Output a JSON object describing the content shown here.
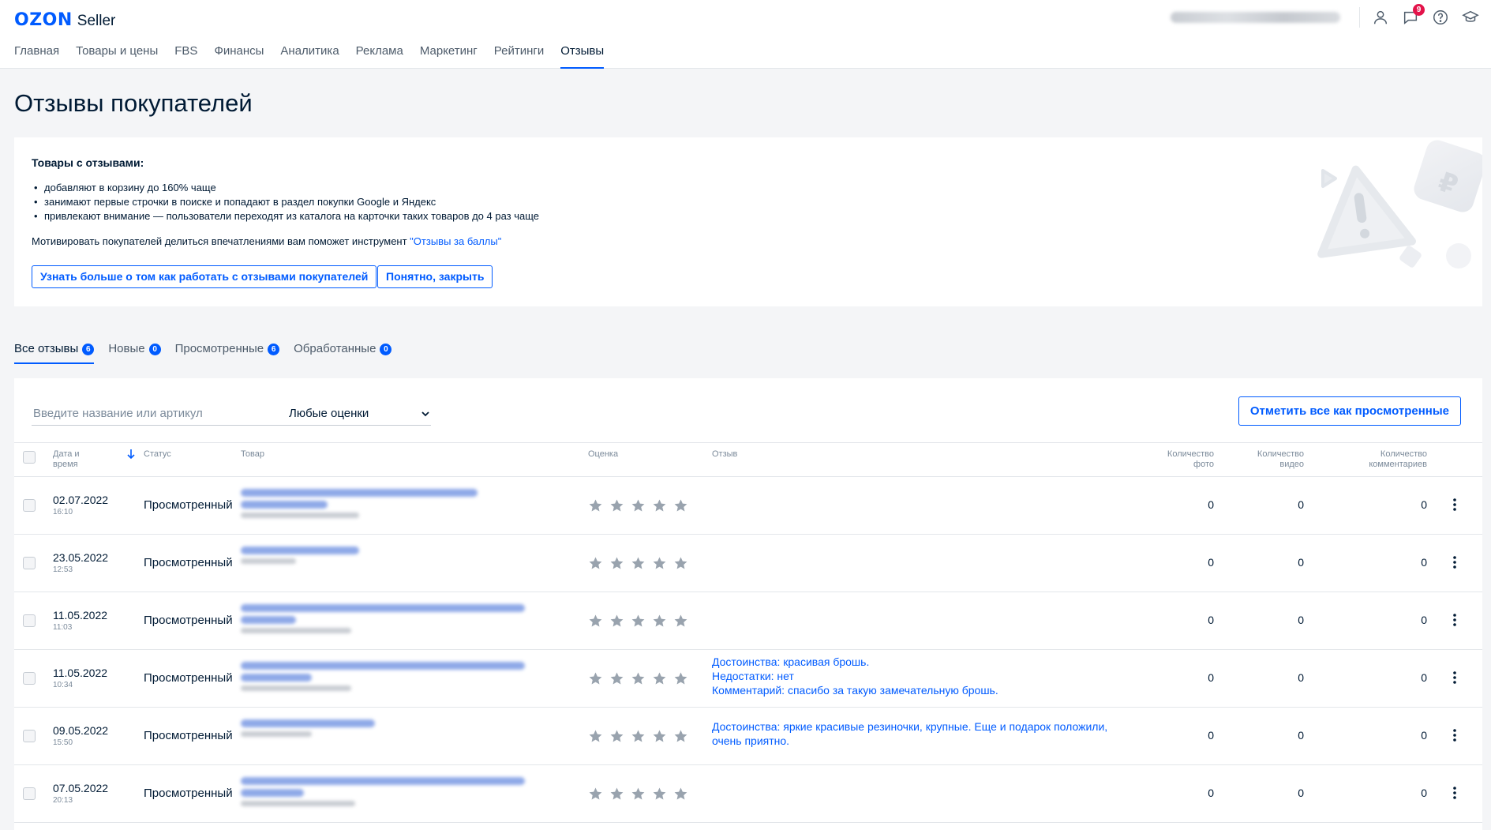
{
  "header": {
    "logo_brand": "OZON",
    "logo_product": "Seller",
    "notifications_count": "9",
    "nav": [
      "Главная",
      "Товары и цены",
      "FBS",
      "Финансы",
      "Аналитика",
      "Реклама",
      "Маркетинг",
      "Рейтинги",
      "Отзывы"
    ],
    "active_nav": "Отзывы"
  },
  "page": {
    "title": "Отзывы покупателей"
  },
  "banner": {
    "title": "Товары с отзывами:",
    "bullets": [
      "добавляют в корзину до 160% чаще",
      "занимают первые строчки в поиске и попадают в раздел покупки Google и Яндекс",
      "привлекают внимание — пользователи переходят из каталога на карточки таких товаров до 4 раз чаще"
    ],
    "motivation_text": "Мотивировать покупателей делиться впечатлениями вам поможет инструмент ",
    "motivation_link": "\"Отзывы за баллы\"",
    "learn_more_button": "Узнать больше о том как работать с отзывами покупателей",
    "close_button": "Понятно, закрыть"
  },
  "tabs": [
    {
      "label": "Все отзывы",
      "count": "6",
      "active": true
    },
    {
      "label": "Новые",
      "count": "0",
      "active": false
    },
    {
      "label": "Просмотренные",
      "count": "6",
      "active": false
    },
    {
      "label": "Обработанные",
      "count": "0",
      "active": false
    }
  ],
  "filters": {
    "search_placeholder": "Введите название или артикул",
    "rating_select": "Любые оценки",
    "mark_all_button": "Отметить все как просмотренные"
  },
  "table": {
    "columns": {
      "date": "Дата и\nвремя",
      "status": "Статус",
      "product": "Товар",
      "rating": "Оценка",
      "review": "Отзыв",
      "photo_count": "Количество\nфото",
      "video_count": "Количество\nвидео",
      "comment_count": "Количество\nкомментариев"
    },
    "rows": [
      {
        "date": "02.07.2022",
        "time": "16:10",
        "status": "Просмотренный",
        "rating": 5,
        "review": [],
        "photos": "0",
        "videos": "0",
        "comments": "0"
      },
      {
        "date": "23.05.2022",
        "time": "12:53",
        "status": "Просмотренный",
        "rating": 5,
        "review": [],
        "photos": "0",
        "videos": "0",
        "comments": "0"
      },
      {
        "date": "11.05.2022",
        "time": "11:03",
        "status": "Просмотренный",
        "rating": 5,
        "review": [],
        "photos": "0",
        "videos": "0",
        "comments": "0"
      },
      {
        "date": "11.05.2022",
        "time": "10:34",
        "status": "Просмотренный",
        "rating": 5,
        "review": [
          "Достоинства: красивая брошь.",
          "Недостатки: нет",
          "Комментарий: спасибо за такую замечательную брошь."
        ],
        "photos": "0",
        "videos": "0",
        "comments": "0"
      },
      {
        "date": "09.05.2022",
        "time": "15:50",
        "status": "Просмотренный",
        "rating": 5,
        "review": [
          "Достоинства: яркие красивые резиночки, крупные. Еще и подарок положили,",
          "очень приятно."
        ],
        "photos": "0",
        "videos": "0",
        "comments": "0"
      },
      {
        "date": "07.05.2022",
        "time": "20:13",
        "status": "Просмотренный",
        "rating": 5,
        "review": [],
        "photos": "0",
        "videos": "0",
        "comments": "0"
      }
    ]
  },
  "colors": {
    "accent": "#005bff",
    "text": "#001a34",
    "muted": "#7b8a9a",
    "star": "#99a3ae",
    "badge_red": "#e3134a"
  }
}
